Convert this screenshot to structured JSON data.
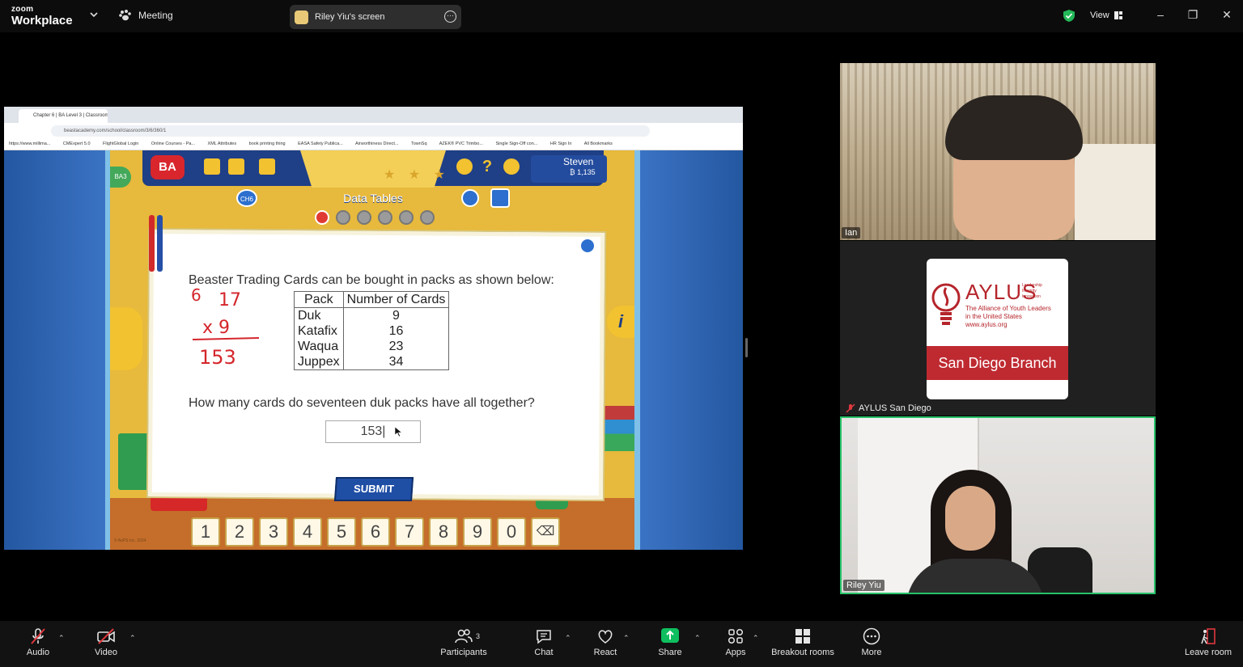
{
  "topbar": {
    "brand_line1": "zoom",
    "brand_line2": "Workplace",
    "meeting_label": "Meeting",
    "screen_share_label": "Riley Yiu's screen",
    "view_label": "View"
  },
  "browser": {
    "tab_title": "Chapter 6 | BA Level 3 | Classroom",
    "url": "beastacademy.com/school/classroom/3/6/360/1",
    "bookmarks": [
      "https://www.millima...",
      "CMExpert 5.0",
      "FlightGlobal Login",
      "Online Courses - Pa...",
      "XML Attributes",
      "book printing thing",
      "EASA Safety Publica...",
      "Airworthiness Direct...",
      "TownSq",
      "AZEK® PVC Trimbo...",
      "Single Sign-Off con...",
      "HR Sign In",
      "All Bookmarks"
    ]
  },
  "game": {
    "logo": "BA",
    "user_name": "Steven",
    "user_points": "₿ 1,135",
    "lesson_title": "Data Tables",
    "chapter_badge": "CH6",
    "side_badge": "BA3",
    "info_label": "i",
    "stars": "★ ★ ★",
    "question_intro": "Beaster Trading Cards can be bought in packs as shown below:",
    "table": {
      "headers": [
        "Pack",
        "Number of Cards"
      ],
      "rows": [
        [
          "Duk",
          "9"
        ],
        [
          "Katafix",
          "16"
        ],
        [
          "Waqua",
          "23"
        ],
        [
          "Juppex",
          "34"
        ]
      ]
    },
    "scratch_work": [
      "6",
      "17",
      "x 9",
      "153"
    ],
    "question": "How many cards do seventeen duk packs have all together?",
    "answer_value": "153|",
    "submit_label": "SUBMIT",
    "numpad": [
      "1",
      "2",
      "3",
      "4",
      "5",
      "6",
      "7",
      "8",
      "9",
      "0"
    ],
    "copyright": "© AoPS Inc. 2024"
  },
  "participants": [
    {
      "name": "Ian"
    },
    {
      "name": "AYLUS San Diego",
      "muted": true
    },
    {
      "name": "Riley Yiu",
      "active_speaker": true
    }
  ],
  "aylus_card": {
    "name": "AYLUS",
    "tagline": [
      "Leadership",
      "Integrity",
      "Innovation"
    ],
    "subtitle": [
      "The Alliance of Youth Leaders",
      "in the United States",
      "www.aylus.org"
    ],
    "branch": "San Diego Branch",
    "brand_color": "#bf2a31"
  },
  "toolbar": {
    "audio": "Audio",
    "video": "Video",
    "participants": "Participants",
    "participants_count": "3",
    "chat": "Chat",
    "react": "React",
    "share": "Share",
    "apps": "Apps",
    "breakout": "Breakout rooms",
    "more": "More",
    "leave": "Leave room",
    "share_color": "#0fbf5f",
    "muted_color": "#e0383e"
  }
}
